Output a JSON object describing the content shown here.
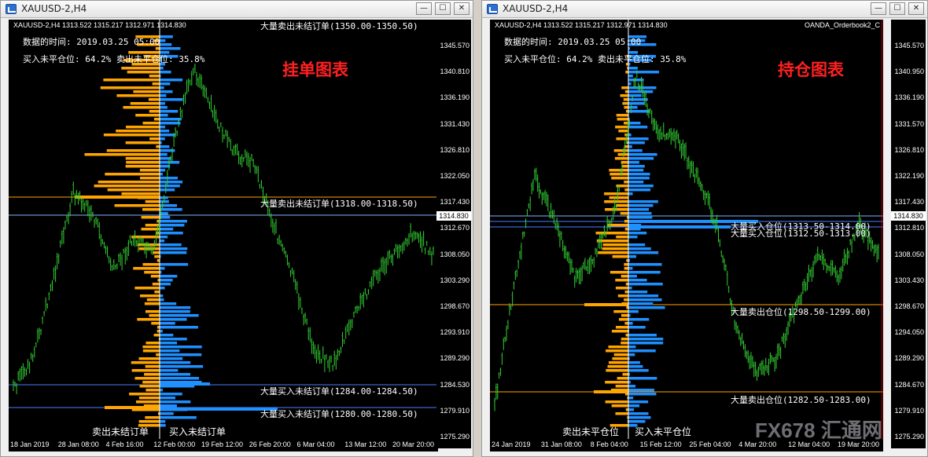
{
  "left_window": {
    "title": "XAUUSD-2,H4",
    "ohlc": "XAUUSD-2,H4  1313.522 1315.217 1312.971 1314.830",
    "data_time_label": "数据的时间: 2019.03.25 05:00",
    "ratio_label": "买入未平仓位: 64.2%  卖出未平仓位: 35.8%",
    "big_title": "挂单图表",
    "current_price": "1314.830",
    "level_labels": [
      "大量卖出未结订单(1350.00-1350.50)",
      "大量卖出未结订单(1318.00-1318.50)",
      "大量买入未结订单(1284.00-1284.50)",
      "大量买入未结订单(1280.00-1280.50)"
    ],
    "footer_left": "卖出未结订单",
    "footer_right": "买入未结订单",
    "price_ticks": [
      "1345.570",
      "1340.810",
      "1336.190",
      "1331.430",
      "1326.810",
      "1322.050",
      "1317.430",
      "1312.670",
      "1308.050",
      "1303.290",
      "1298.670",
      "1293.910",
      "1289.290",
      "1284.530",
      "1279.910",
      "1275.290"
    ],
    "time_ticks": [
      "18 Jan 2019",
      "28 Jan 08:00",
      "4 Feb 16:00",
      "12 Feb 00:00",
      "19 Feb 12:00",
      "26 Feb 20:00",
      "6 Mar 04:00",
      "13 Mar 12:00",
      "20 Mar 20:00"
    ]
  },
  "right_window": {
    "title": "XAUUSD-2,H4",
    "ohlc": "XAUUSD-2,H4  1313.522 1315.217 1312.971 1314.830",
    "indicator": "OANDA_Orderbook2_C",
    "data_time_label": "数据的时间: 2019.03.25 05:00",
    "ratio_label": "买入未平仓位: 64.2%  卖出未平仓位: 35.8%",
    "big_title": "持仓图表",
    "current_price": "1314.830",
    "level_labels": [
      "大量买入仓位(1313.50-1314.00)",
      "大量买入仓位(1312.50-1313.00)",
      "大量卖出仓位(1298.50-1299.00)",
      "大量卖出仓位(1282.50-1283.00)"
    ],
    "footer_left": "卖出未平仓位",
    "footer_right": "买入未平仓位",
    "price_ticks": [
      "1345.570",
      "1340.950",
      "1336.190",
      "1331.570",
      "1326.810",
      "1322.190",
      "1317.430",
      "1312.810",
      "1308.050",
      "1303.430",
      "1298.670",
      "1294.050",
      "1289.290",
      "1284.670",
      "1279.910",
      "1275.290"
    ],
    "time_ticks": [
      "24 Jan 2019",
      "31 Jan 08:00",
      "8 Feb 04:00",
      "15 Feb 12:00",
      "25 Feb 04:00",
      "4 Mar 20:00",
      "12 Mar 04:00",
      "19 Mar 20:00"
    ]
  },
  "window_buttons": {
    "minimize": "—",
    "maximize": "☐",
    "close": "✕"
  },
  "watermark": "FX678 汇通网",
  "colors": {
    "sell": "#ffa500",
    "buy": "#1e90ff",
    "candles": "#32cd32",
    "background": "#000000",
    "title_red": "#ff2020"
  }
}
